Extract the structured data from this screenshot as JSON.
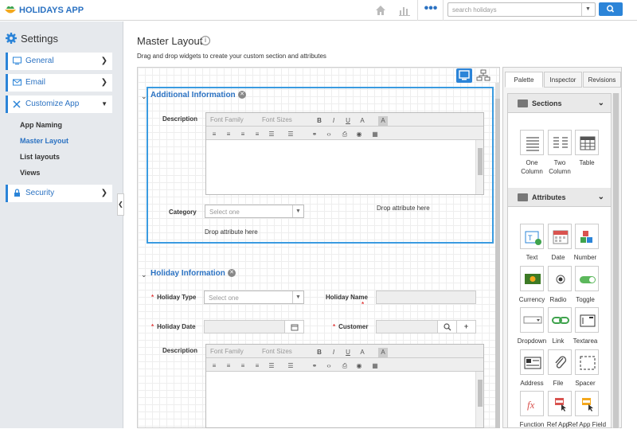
{
  "app": {
    "name": "HOLIDAYS APP"
  },
  "topbar": {
    "search_placeholder": "search holidays"
  },
  "sidebar": {
    "title": "Settings",
    "items": [
      {
        "label": "General"
      },
      {
        "label": "Email"
      },
      {
        "label": "Customize App"
      },
      {
        "label": "Security"
      }
    ],
    "subitems": [
      "App Naming",
      "Master Layout",
      "List layouts",
      "Views"
    ]
  },
  "page": {
    "title": "Master Layout",
    "subtitle": "Drag and drop widgets to create your custom section and attributes"
  },
  "section1": {
    "title": "Additional Information",
    "description_label": "Description",
    "category_label": "Category",
    "category_placeholder": "Select one",
    "drop1": "Drop attribute here",
    "drop2": "Drop attribute here"
  },
  "section2": {
    "title": "Holiday Information",
    "holiday_type_label": "Holiday Type",
    "holiday_type_placeholder": "Select one",
    "holiday_name_label": "Holiday Name",
    "holiday_date_label": "Holiday Date",
    "customer_label": "Customer",
    "description_label": "Description"
  },
  "editor": {
    "font_family": "Font Family",
    "font_sizes": "Font Sizes"
  },
  "panel": {
    "tabs": [
      "Palette",
      "Inspector",
      "Revisions"
    ],
    "sections_header": "Sections",
    "attributes_header": "Attributes",
    "section_widgets": [
      "One Column",
      "Two Column",
      "Table"
    ],
    "attribute_widgets": [
      "Text",
      "Date",
      "Number",
      "Currency",
      "Radio",
      "Toggle",
      "Dropdown",
      "Link",
      "Textarea",
      "Address",
      "File",
      "Spacer",
      "Function",
      "Ref App",
      "Ref App Field"
    ]
  }
}
